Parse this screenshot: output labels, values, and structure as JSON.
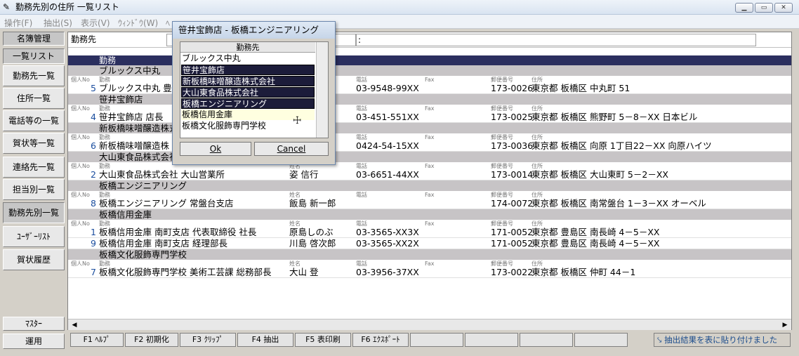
{
  "window": {
    "title": "勤務先別の住所 一覧リスト",
    "icon": "app-icon"
  },
  "menu": [
    "操作(F)",
    "抽出(S)",
    "表示(V)",
    "ｳｨﾝﾄﾞｳ(W)",
    "ﾍ"
  ],
  "sidebar": [
    {
      "label": "名簿管理",
      "active": true
    },
    {
      "label": "一覧リスト",
      "active": true
    },
    {
      "label": "勤務先一覧"
    },
    {
      "label": "住所一覧"
    },
    {
      "label": "電話等の一覧"
    },
    {
      "label": "賀状等一覧"
    },
    {
      "label": "連絡先一覧"
    },
    {
      "label": "担当別一覧"
    },
    {
      "label": "勤務先別一覧"
    },
    {
      "label": "ﾕｰｻﾞｰﾘｽﾄ"
    },
    {
      "label": "賀状履歴"
    },
    {
      "label": "ﾏｽﾀｰ"
    },
    {
      "label": "運用"
    }
  ],
  "filter": {
    "label": "勤務先",
    "colon": ":"
  },
  "list": {
    "header": "勤務",
    "col_labels": {
      "no": "個人No",
      "work": "勤務",
      "name": "姓名",
      "tel": "電話",
      "fax": "Fax",
      "zip": "郵便番号",
      "addr": "住所"
    },
    "groups": [
      {
        "name": "ブルックス中丸",
        "rows": [
          {
            "no": "5",
            "work": "ブルックス中丸 豊島",
            "name": "",
            "tel": "03-9548-99XX",
            "zip": "173-0026",
            "addr": "東京都 板橋区 中丸町 51"
          }
        ]
      },
      {
        "name": "笹井宝飾店",
        "rows": [
          {
            "no": "4",
            "work": "笹井宝飾店 店長",
            "name": "",
            "tel": "03-451-551XX",
            "zip": "173-0025",
            "addr": "東京都 板橋区 熊野町 5－8－XX 日本ビル"
          }
        ]
      },
      {
        "name": "新板橋味噌醸造株式会社",
        "rows": [
          {
            "no": "6",
            "work": "新板橋味噌醸造株",
            "name": "",
            "tel": "0424-54-15XX",
            "zip": "173-0036",
            "addr": "東京都 板橋区 向原 1丁目22－XX 向原ハイツ"
          }
        ]
      },
      {
        "name": "大山東食品株式会社",
        "rows": [
          {
            "no": "2",
            "work": "大山東食品株式会社 大山営業所",
            "name": "姿 信行",
            "tel": "03-6651-44XX",
            "zip": "173-0014",
            "addr": "東京都 板橋区 大山東町 5－2－XX"
          }
        ]
      },
      {
        "name": "板橋エンジニアリング",
        "rows": [
          {
            "no": "8",
            "work": "板橋エンジニアリング 常盤台支店",
            "name": "飯島 新一郎",
            "tel": "",
            "zip": "174-0072",
            "addr": "東京都 板橋区 南常盤台 1－3－XX オーベル"
          }
        ]
      },
      {
        "name": "板橋信用金庫",
        "rows": [
          {
            "no": "1",
            "work": "板橋信用金庫 南町支店 代表取締役 社長",
            "name": "原島しのぶ",
            "tel": "03-3565-XX3X",
            "zip": "171-0052",
            "addr": "東京都 豊島区 南長崎 4－5－XX"
          },
          {
            "no": "9",
            "work": "板橋信用金庫 南町支店 経理部長",
            "name": "川島 啓次郎",
            "tel": "03-3565-XX2X",
            "zip": "171-0052",
            "addr": "東京都 豊島区 南長崎 4－5－XX"
          }
        ]
      },
      {
        "name": "板橋文化服飾専門学校",
        "rows": [
          {
            "no": "7",
            "work": "板橋文化服飾専門学校 美術工芸課 総務部長",
            "name": "大山 登",
            "tel": "03-3956-37XX",
            "zip": "173-0022",
            "addr": "東京都 板橋区 仲町 44－1"
          }
        ]
      }
    ]
  },
  "fkeys": [
    "F1 ﾍﾙﾌﾟ",
    "F2 初期化",
    "F3 ｸﾘｯﾌﾟ",
    "F4 抽出",
    "F5 表印刷",
    "F6 ｴｸｽﾎﾟｰﾄ"
  ],
  "status": "抽出結果を表に貼り付けました",
  "dialog": {
    "title": "笹井宝飾店 - 板橋エンジニアリング",
    "list_header": "勤務先",
    "options": [
      {
        "label": "ブルックス中丸",
        "selected": false
      },
      {
        "label": "笹井宝飾店",
        "selected": true
      },
      {
        "label": "新板橋味噌醸造株式会社",
        "selected": true
      },
      {
        "label": "大山東食品株式会社",
        "selected": true
      },
      {
        "label": "板橋エンジニアリング",
        "selected": true
      },
      {
        "label": "板橋信用金庫",
        "selected": false,
        "focus": true
      },
      {
        "label": "板橋文化服飾専門学校",
        "selected": false
      }
    ],
    "ok_label": "Ok",
    "cancel_label": "Cancel"
  }
}
